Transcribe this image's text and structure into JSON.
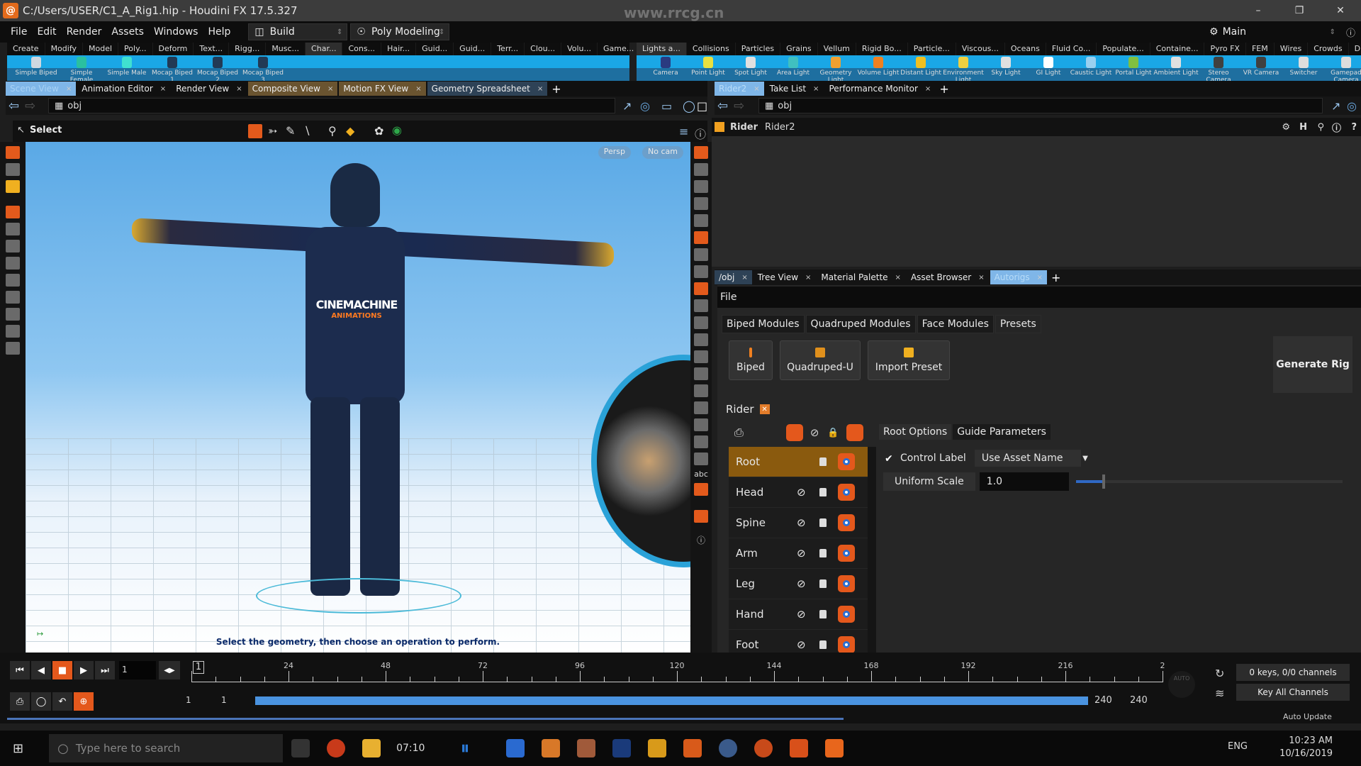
{
  "window": {
    "title": "C:/Users/USER/C1_A_Rig1.hip - Houdini FX 17.5.327",
    "watermark": "www.rrcg.cn",
    "controls": [
      "minimize",
      "restore",
      "close"
    ]
  },
  "menubar": {
    "items": [
      "File",
      "Edit",
      "Render",
      "Assets",
      "Windows",
      "Help"
    ],
    "desktop": "Build",
    "workspace": "Poly Modeling",
    "main_label": "Main"
  },
  "shelf_left": {
    "tabs": [
      "Create",
      "Modify",
      "Model",
      "Poly...",
      "Deform",
      "Text...",
      "Rigg...",
      "Musc...",
      "Char...",
      "Cons...",
      "Hair...",
      "Guid...",
      "Guid...",
      "Terr...",
      "Clou...",
      "Volu...",
      "Game..."
    ],
    "active_tab": "Char...",
    "tools": [
      "Simple Biped",
      "Simple Female",
      "Simple Male",
      "Mocap Biped 1",
      "Mocap Biped 2",
      "Mocap Biped 3"
    ]
  },
  "shelf_right": {
    "tabs": [
      "Lights a...",
      "Collisions",
      "Particles",
      "Grains",
      "Vellum",
      "Rigid Bo...",
      "Particle...",
      "Viscous...",
      "Oceans",
      "Fluid Co...",
      "Populate...",
      "Containe...",
      "Pyro FX",
      "FEM",
      "Wires",
      "Crowds",
      "Drive Si..."
    ],
    "active_tab": "Lights a...",
    "tools": [
      "Camera",
      "Point Light",
      "Spot Light",
      "Area Light",
      "Geometry Light",
      "Volume Light",
      "Distant Light",
      "Environment Light",
      "Sky Light",
      "GI Light",
      "Caustic Light",
      "Portal Light",
      "Ambient Light",
      "Stereo Camera",
      "VR Camera",
      "Switcher",
      "Gamepad Camera"
    ]
  },
  "left_pane": {
    "tabs": [
      {
        "label": "Scene View",
        "style": "scene"
      },
      {
        "label": "Animation Editor",
        "style": ""
      },
      {
        "label": "Render View",
        "style": ""
      },
      {
        "label": "Composite View",
        "style": "comp"
      },
      {
        "label": "Motion FX View",
        "style": "comp"
      },
      {
        "label": "Geometry Spreadsheet",
        "style": "geo"
      }
    ],
    "path": "obj",
    "tool_label": "Select",
    "viewport": {
      "camera_view": "Persp",
      "camera": "No cam",
      "status_message": "Select the geometry, then choose an operation to perform.",
      "character_text": "CINEMACHINE",
      "character_subtext": "ANIMATIONS"
    }
  },
  "right_top_pane": {
    "tabs": [
      {
        "label": "Rider2",
        "style": "sel"
      },
      {
        "label": "Take List",
        "style": ""
      },
      {
        "label": "Performance Monitor",
        "style": ""
      }
    ],
    "path": "obj",
    "node_type": "Rider",
    "node_name": "Rider2"
  },
  "right_bottom_pane": {
    "tabs": [
      {
        "label": "/obj",
        "style": "geo"
      },
      {
        "label": "Tree View",
        "style": ""
      },
      {
        "label": "Material Palette",
        "style": ""
      },
      {
        "label": "Asset Browser",
        "style": ""
      },
      {
        "label": "Autorigs",
        "style": "sel"
      }
    ],
    "file_menu": "File",
    "module_tabs": [
      "Biped Modules",
      "Quadruped Modules",
      "Face Modules",
      "Presets"
    ],
    "active_module_tab": "Presets",
    "presets": [
      "Biped",
      "Quadruped-U",
      "Import Preset"
    ],
    "generate_button": "Generate Rig",
    "rig_name": "Rider",
    "modules": [
      {
        "name": "Root",
        "selected": true
      },
      {
        "name": "Head",
        "selected": false
      },
      {
        "name": "Spine",
        "selected": false
      },
      {
        "name": "Arm",
        "selected": false
      },
      {
        "name": "Leg",
        "selected": false
      },
      {
        "name": "Hand",
        "selected": false
      },
      {
        "name": "Foot",
        "selected": false
      }
    ],
    "option_tabs": [
      "Root Options",
      "Guide Parameters"
    ],
    "active_option_tab": "Root Options",
    "params": {
      "control_label": {
        "label": "Control Label",
        "checked": true,
        "value": "Use Asset Name"
      },
      "uniform_scale": {
        "label": "Uniform Scale",
        "value": "1.0",
        "slider_fraction": 0.1
      }
    }
  },
  "timeline": {
    "current_frame": "1",
    "frame_marker": "1",
    "ticks": [
      "24",
      "48",
      "72",
      "96",
      "120",
      "144",
      "168",
      "192",
      "216",
      "2"
    ],
    "range_start": "1",
    "range_start2": "1",
    "range_end": "240",
    "range_end2": "240",
    "auto_label": "AUTO",
    "keys_status": "0 keys, 0/0 channels",
    "key_mode": "Key All Channels",
    "auto_update": "Auto Update"
  },
  "taskbar": {
    "search_placeholder": "Type here to search",
    "media_time": "07:10",
    "language": "ENG",
    "time": "10:23 AM",
    "date": "10/16/2019"
  }
}
